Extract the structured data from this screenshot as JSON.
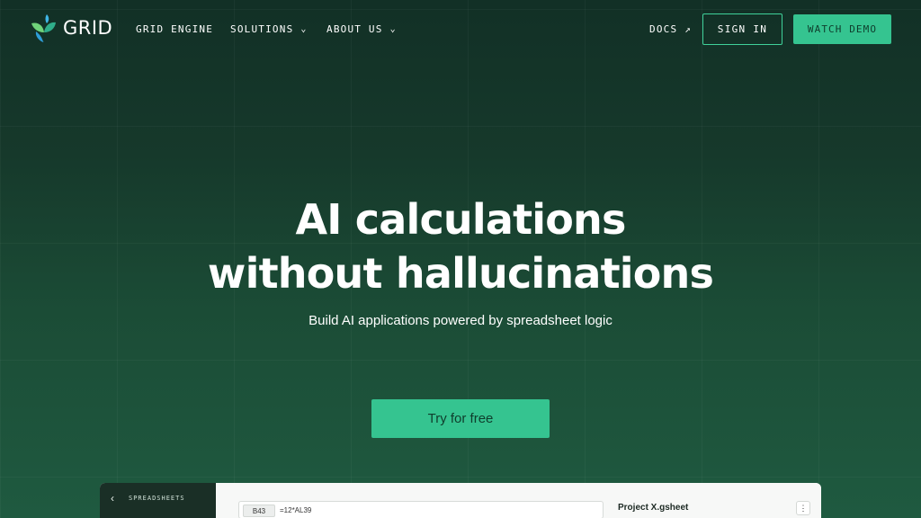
{
  "brand": {
    "name": "GRID",
    "logo_icon": "grid-leaf-logo"
  },
  "nav": {
    "items": [
      {
        "label": "GRID ENGINE",
        "has_dropdown": false
      },
      {
        "label": "SOLUTIONS",
        "has_dropdown": true
      },
      {
        "label": "ABOUT US",
        "has_dropdown": true
      }
    ],
    "docs_label": "DOCS",
    "docs_icon": "external-arrow-icon",
    "sign_in_label": "SIGN IN",
    "watch_demo_label": "WATCH DEMO"
  },
  "hero": {
    "title_line1": "AI calculations",
    "title_line2": "without hallucinations",
    "subtitle": "Build AI applications powered by spreadsheet logic",
    "cta_label": "Try for free"
  },
  "preview": {
    "sidebar_label": "SPREADSHEETS",
    "cell_ref": "B43",
    "formula": "=12*AL39",
    "file_name": "Project X.gsheet"
  },
  "colors": {
    "accent": "#35c490",
    "background_top": "#123026",
    "background_bottom": "#1f5a40",
    "text": "#ffffff"
  }
}
